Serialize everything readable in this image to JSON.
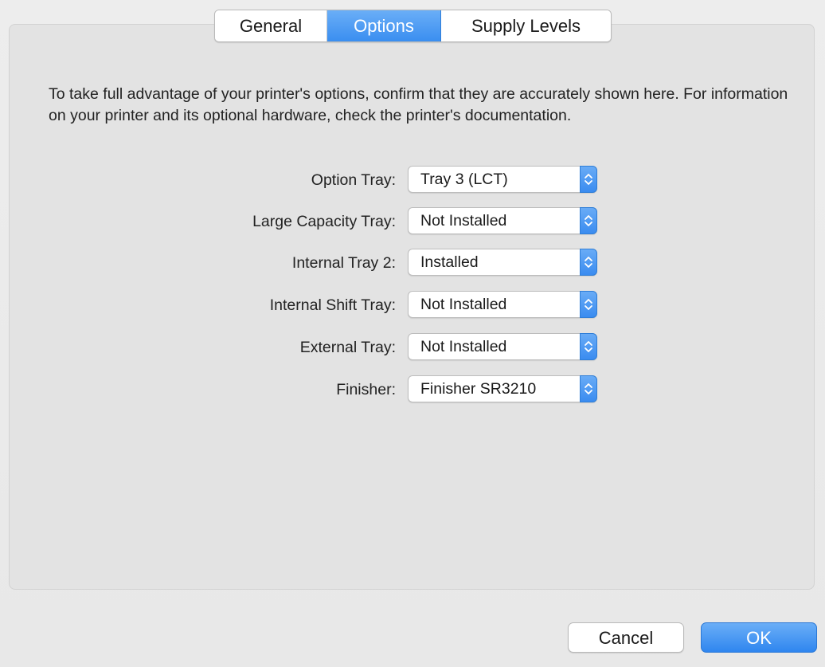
{
  "tabs": [
    {
      "label": "General",
      "active": false
    },
    {
      "label": "Options",
      "active": true
    },
    {
      "label": "Supply Levels",
      "active": false
    }
  ],
  "intro_text": "To take full advantage of your printer's options, confirm that they are accurately shown here. For information on your printer and its optional hardware, check the printer's documentation.",
  "options": [
    {
      "label": "Option Tray:",
      "value": "Tray 3 (LCT)"
    },
    {
      "label": "Large Capacity Tray:",
      "value": "Not Installed"
    },
    {
      "label": "Internal Tray 2:",
      "value": "Installed"
    },
    {
      "label": "Internal Shift Tray:",
      "value": "Not Installed"
    },
    {
      "label": "External Tray:",
      "value": "Not Installed"
    },
    {
      "label": "Finisher:",
      "value": "Finisher SR3210"
    }
  ],
  "buttons": {
    "cancel": "Cancel",
    "ok": "OK"
  },
  "icons": {
    "popup_stepper": "up-down-chevron-icon"
  },
  "colors": {
    "accent": "#3a8ef0",
    "panel": "#e3e3e3",
    "window": "#ececec"
  }
}
